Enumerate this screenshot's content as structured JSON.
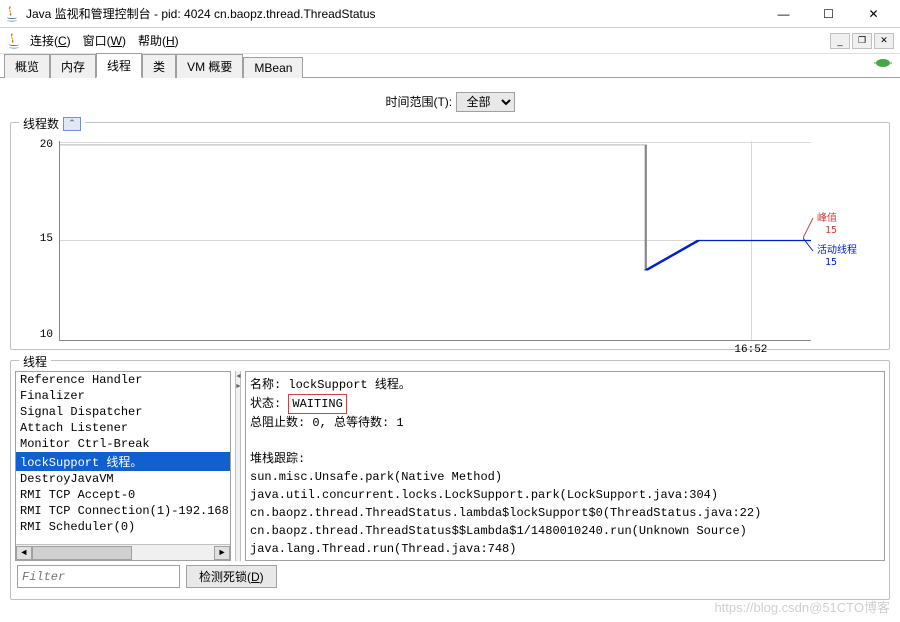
{
  "window": {
    "title": "Java 监视和管理控制台 - pid: 4024 cn.baopz.thread.ThreadStatus",
    "min": "—",
    "max": "☐",
    "close": "✕"
  },
  "menu": {
    "connect": "连接(C)",
    "window": "窗口(W)",
    "help": "帮助(H)"
  },
  "tabs": {
    "overview": "概览",
    "memory": "内存",
    "threads": "线程",
    "classes": "类",
    "vm": "VM 概要",
    "mbean": "MBean"
  },
  "timerange": {
    "label": "时间范围(T):",
    "value": "全部"
  },
  "chart": {
    "title": "线程数"
  },
  "chart_data": {
    "type": "line",
    "ylabels": [
      "10",
      "15",
      "20"
    ],
    "xlabels": [
      "16:52"
    ],
    "series": [
      {
        "name": "活动线程",
        "color": "#0020d0",
        "latest": "15",
        "end_y": 15
      },
      {
        "name": "峰值",
        "color": "#d04040",
        "latest": "15",
        "end_y": 15
      }
    ],
    "legend": {
      "peak_label": "峰值",
      "peak_value": "15",
      "active_label": "活动线程",
      "active_value": "15"
    },
    "ylim": [
      8,
      22
    ]
  },
  "threads": {
    "title": "线程",
    "list": [
      "Reference Handler",
      "Finalizer",
      "Signal Dispatcher",
      "Attach Listener",
      "Monitor Ctrl-Break",
      "lockSupport 线程。",
      "DestroyJavaVM",
      "RMI TCP Accept-0",
      "RMI TCP Connection(1)-192.168.",
      "RMI Scheduler(0)"
    ],
    "selected_index": 5,
    "detail": {
      "name_label": "名称:",
      "name_value": "lockSupport 线程。",
      "status_label": "状态:",
      "status_value": "WAITING",
      "blocked_label": "总阻止数:",
      "blocked_value": "0,",
      "waited_label": "总等待数:",
      "waited_value": "1",
      "stack_label": "堆栈跟踪:",
      "stack": [
        "sun.misc.Unsafe.park(Native Method)",
        "java.util.concurrent.locks.LockSupport.park(LockSupport.java:304)",
        "cn.baopz.thread.ThreadStatus.lambda$lockSupport$0(ThreadStatus.java:22)",
        "cn.baopz.thread.ThreadStatus$$Lambda$1/1480010240.run(Unknown Source)",
        "java.lang.Thread.run(Thread.java:748)"
      ]
    },
    "filter_placeholder": "Filter",
    "deadlock_btn": "检测死锁(D)"
  },
  "watermark": "https://blog.csdn@51CTO博客"
}
